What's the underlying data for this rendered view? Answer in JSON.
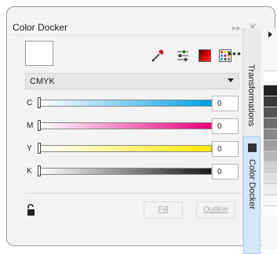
{
  "docker": {
    "title": "Color Docker",
    "title_icons": {
      "collapse": "collapse-arrows-icon",
      "close": "close-icon"
    },
    "color_model": {
      "selected": "CMYK"
    },
    "channels": [
      {
        "key": "c",
        "label": "C",
        "value": "0",
        "color": "#00a0e6"
      },
      {
        "key": "m",
        "label": "M",
        "value": "0",
        "color": "#e6007e"
      },
      {
        "key": "y",
        "label": "Y",
        "value": "0",
        "color": "#ffea00"
      },
      {
        "key": "k",
        "label": "K",
        "value": "0",
        "color": "#1a1a1a"
      }
    ],
    "buttons": {
      "fill": "Fill",
      "outline": "Outline"
    },
    "more_label": "•••"
  },
  "tabs": {
    "transformations": "Transformations",
    "color_docker": "Color Docker"
  },
  "colors": {
    "accent_tab": "#d4e6fb",
    "red_swatch": "#e00000"
  }
}
